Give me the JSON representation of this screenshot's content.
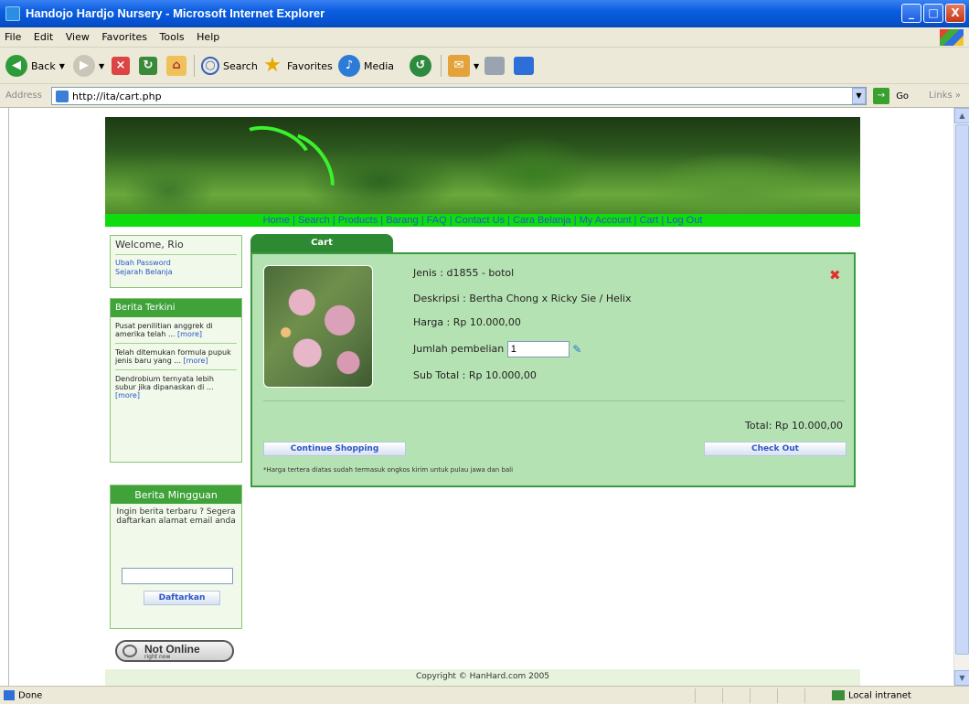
{
  "window": {
    "title": "Handojo Hardjo Nursery - Microsoft Internet Explorer",
    "min_glyph": "_",
    "max_glyph": "□",
    "close_glyph": "X"
  },
  "menubar": {
    "items": [
      "File",
      "Edit",
      "View",
      "Favorites",
      "Tools",
      "Help"
    ]
  },
  "toolbar": {
    "back_label": "Back",
    "search_label": "Search",
    "favorites_label": "Favorites",
    "media_label": "Media"
  },
  "address": {
    "label": "Address",
    "url": "http://ita/cart.php",
    "go_label": "Go",
    "links_label": "Links"
  },
  "nav": {
    "items": [
      "Home",
      "Search",
      "Products",
      "Barang",
      "FAQ",
      "Contact Us",
      "Cara Belanja",
      "My Account",
      "Cart",
      "Log Out"
    ]
  },
  "sidebar": {
    "welcome": "Welcome, Rio",
    "links": [
      "Ubah Password",
      "Sejarah Belanja"
    ],
    "news_title": "Berita Terkini",
    "news": [
      {
        "text": "Pusat penilitian anggrek di amerika telah ...",
        "more": "[more]"
      },
      {
        "text": "Telah ditemukan formula pupuk jenis baru yang ...",
        "more": "[more]"
      },
      {
        "text": "Dendrobium ternyata lebih subur jika dipanaskan di ...",
        "more": "[more]"
      }
    ],
    "weekly_title": "Berita Mingguan",
    "weekly_text": "Ingin berita terbaru ? Segera daftarkan alamat email anda",
    "weekly_input": "",
    "weekly_button": "Daftarkan",
    "online_label": "Not Online",
    "online_sub": "right now"
  },
  "cart": {
    "tab_label": "Cart",
    "item": {
      "jenis": "Jenis : d1855 - botol",
      "deskripsi": "Deskripsi : Bertha Chong x Ricky Sie / Helix",
      "harga": "Harga : Rp 10.000,00",
      "jumlah_label": "Jumlah pembelian",
      "jumlah_value": "1",
      "subtotal": "Sub Total : Rp 10.000,00"
    },
    "total": "Total: Rp 10.000,00",
    "continue_label": "Continue Shopping",
    "checkout_label": "Check Out",
    "note": "*Harga tertera diatas sudah termasuk ongkos kirim untuk pulau jawa dan bali"
  },
  "footer": {
    "copyright": "Copyright © HanHard.com 2005"
  },
  "status": {
    "left": "Done",
    "zone": "Local intranet"
  },
  "colors": {
    "nav_bg": "#0fdc0f",
    "panel_bg": "#b5e2b2",
    "accent": "#2d8a33",
    "link": "#2c55c8"
  }
}
